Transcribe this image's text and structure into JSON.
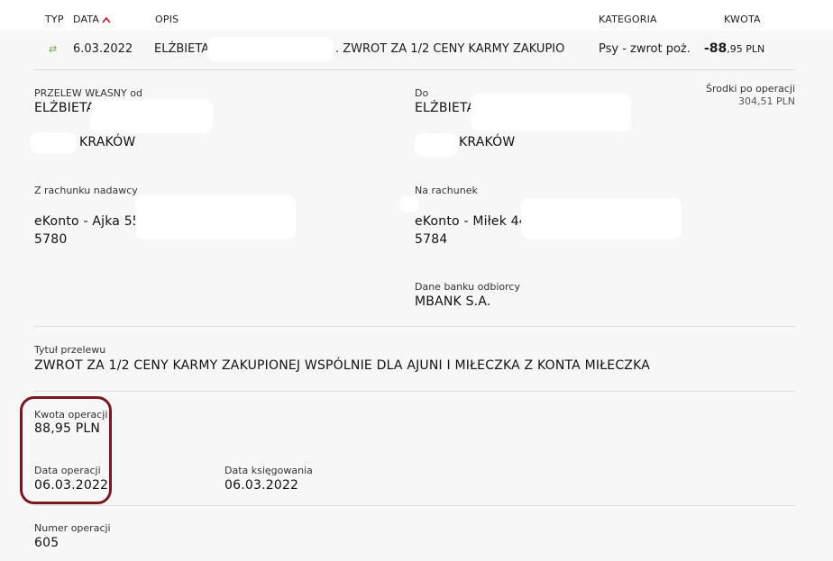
{
  "header": {
    "type": "TYP",
    "date": "DATA",
    "description": "OPIS",
    "category": "KATEGORIA",
    "amount": "KWOTA"
  },
  "row": {
    "date": "6.03.2022",
    "name": "ELŻBIETA",
    "description": ". ZWROT ZA 1/2 CENY KARMY ZAKUPIO",
    "category": "Psy - zwrot poż.",
    "amount_int": "-88",
    "amount_dec": ",95 PLN"
  },
  "details": {
    "sender_label": "PRZELEW WŁASNY od",
    "sender_name": "ELŻBIETA",
    "sender_city": "KRAKÓW",
    "recipient_label": "Do",
    "recipient_name": "ELŻBIETA",
    "recipient_city": "KRAKÓW",
    "balance_label": "Środki po operacji",
    "balance_value": "304,51 PLN",
    "from_account_label": "Z rachunku nadawcy",
    "from_account_name": "eKonto - Ajka 55",
    "from_account_suffix": "5780",
    "to_account_label": "Na rachunek",
    "to_account_name": "eKonto - Miłek 44",
    "to_account_suffix": "5784",
    "bank_label": "Dane banku odbiorcy",
    "bank_value": "MBANK S.A.",
    "title_label": "Tytuł przelewu",
    "title_value": "ZWROT ZA 1/2 CENY KARMY ZAKUPIONEJ WSPÓLNIE DLA AJUNI I MIŁECZKA Z KONTA MIŁECZKA",
    "amount_label": "Kwota operacji",
    "amount_value": "88,95 PLN",
    "op_date_label": "Data operacji",
    "op_date_value": "06.03.2022",
    "book_date_label": "Data księgowania",
    "book_date_value": "06.03.2022",
    "op_number_label": "Numer operacji",
    "op_number_value": "605"
  },
  "colors": {
    "highlight": "#7b1721",
    "sort_arrow": "#c8102e",
    "transfer_icon": "#6aa84f"
  },
  "icons": {
    "type": "transfer-arrows-icon",
    "sort": "sort-ascending-icon"
  }
}
